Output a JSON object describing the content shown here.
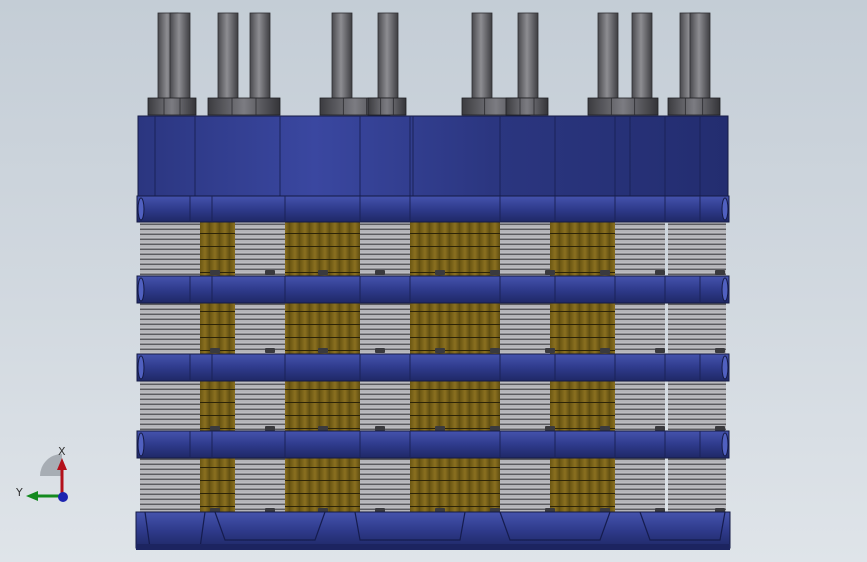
{
  "view": {
    "background_top": "#c4cdd6",
    "background_bottom": "#dfe4e9"
  },
  "model": {
    "plate_color": "#2e3a8a",
    "plate_highlight": "#4b5ab8",
    "core_color": "#7a6416",
    "bolt_color": "#6e6e72",
    "spring_color": "#9a9a9e"
  },
  "triad": {
    "x_label": "X",
    "y_label": "Y",
    "x_color": "#b3101a",
    "y_color": "#138a1e",
    "z_color": "#1c24b0"
  }
}
